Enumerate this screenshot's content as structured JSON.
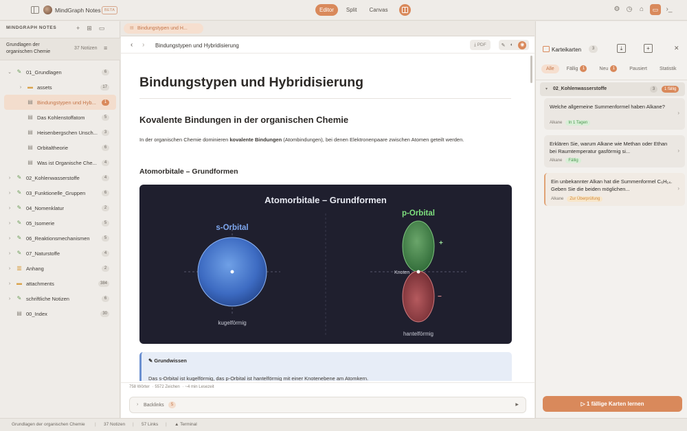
{
  "topbar": {
    "app_name": "MindGraph Notes",
    "beta": "BETA",
    "views": [
      "Editor",
      "Split",
      "Canvas"
    ],
    "active_view": "Editor"
  },
  "sidebar": {
    "title": "MINDGRAPH NOTES",
    "vault_name": "Grundlagen der organischen Chemie",
    "vault_count": "37 Notizen",
    "items": [
      {
        "label": "01_Grundlagen",
        "badge": "6",
        "icon": "pencil-icon",
        "level": 0,
        "expanded": true
      },
      {
        "label": "assets",
        "badge": "17",
        "icon": "folder-icon",
        "level": 1
      },
      {
        "label": "Bindungstypen und Hyb...",
        "badge": "1",
        "icon": "file-icon",
        "level": 1,
        "selected": true
      },
      {
        "label": "Das Kohlenstoffatom",
        "badge": "5",
        "icon": "file-icon",
        "level": 1
      },
      {
        "label": "Heisenbergschen Unsch...",
        "badge": "3",
        "icon": "file-icon",
        "level": 1
      },
      {
        "label": "Orbitaltheorie",
        "badge": "6",
        "icon": "file-icon",
        "level": 1
      },
      {
        "label": "Was ist Organische Che...",
        "badge": "4",
        "icon": "file-icon",
        "level": 1
      },
      {
        "label": "02_Kohlenwasserstoffe",
        "badge": "4",
        "icon": "pencil-icon",
        "level": 0
      },
      {
        "label": "03_Funktionelle_Gruppen",
        "badge": "6",
        "icon": "pencil-icon",
        "level": 0
      },
      {
        "label": "04_Nomenklatur",
        "badge": "2",
        "icon": "pencil-icon",
        "level": 0
      },
      {
        "label": "05_Isomerie",
        "badge": "5",
        "icon": "pencil-icon",
        "level": 0
      },
      {
        "label": "06_Reaktionsmechanismen",
        "badge": "5",
        "icon": "pencil-icon",
        "level": 0
      },
      {
        "label": "07_Naturstoffe",
        "badge": "4",
        "icon": "pencil-icon",
        "level": 0
      },
      {
        "label": "Anhang",
        "badge": "2",
        "icon": "books-icon",
        "level": 0
      },
      {
        "label": "attachments",
        "badge": "384",
        "icon": "folder-icon",
        "level": 0
      },
      {
        "label": "schriftliche Notizen",
        "badge": "6",
        "icon": "pencil-icon",
        "level": 0
      },
      {
        "label": "00_Index",
        "badge": "30",
        "icon": "file-icon",
        "level": 0,
        "no_chevron": true
      }
    ]
  },
  "editor": {
    "tab_label": "Bindungstypen und H...",
    "breadcrumb": "Bindungstypen und Hybridisierung",
    "pdf_label": "PDF",
    "title": "Bindungstypen und Hybridisierung",
    "h2": "Kovalente Bindungen in der organischen Chemie",
    "para_pre": "In der organischen Chemie dominieren ",
    "para_bold": "kovalente Bindungen",
    "para_post": " (Atombindungen), bei denen Elektronenpaare zwischen Atomen geteilt werden.",
    "h3": "Atomorbitale – Grundformen",
    "figure": {
      "title": "Atomorbitale – Grundformen",
      "s_label": "s-Orbital",
      "s_caption": "kugelförmig",
      "p_label": "p-Orbital",
      "p_caption": "hantelförmig",
      "plus": "+",
      "minus": "−",
      "node_label": "Knoten"
    },
    "callout_title": "Grundwissen",
    "callout_text": "Das s-Orbital ist kugelförmig, das p-Orbital ist hantelförmig mit einer Knotenebene am Atomkern.",
    "status": {
      "words": "758 Wörter",
      "chars": "5572 Zeichen",
      "read": "~4 min Lesezeit"
    },
    "backlinks_label": "Backlinks",
    "backlinks_count": "5"
  },
  "flashcards": {
    "title": "Karteikarten",
    "count": "3",
    "filters": [
      {
        "label": "Alle",
        "active": true
      },
      {
        "label": "Fällig",
        "badge": "1"
      },
      {
        "label": "Neu",
        "badge": "1"
      },
      {
        "label": "Pausiert"
      },
      {
        "label": "Statistik"
      }
    ],
    "deck_name": "02_Kohlenwasserstoffe",
    "deck_count": "3",
    "deck_due": "1 fällig",
    "cards": [
      {
        "question": "Welche allgemeine Summenformel haben Alkane?",
        "tag": "Alkane",
        "status": "In 1 Tagen",
        "status_color": "green"
      },
      {
        "question": "Erklären Sie, warum Alkane wie Methan oder Ethan bei Raumtemperatur gasförmig si...",
        "tag": "Alkane",
        "status": "Fällig",
        "status_color": "green"
      },
      {
        "question": "Ein unbekannter Alkan hat die Summenformel C₆H₁₄. Geben Sie die beiden möglichen...",
        "tag": "Alkane",
        "status": "Zur Überprüfung",
        "status_color": "orange"
      }
    ],
    "learn_button": "1 fällige Karten lernen"
  },
  "statusbar": {
    "vault": "Grundlagen der organischen Chemie",
    "notes": "37 Notizen",
    "links": "57 Links",
    "terminal": "Terminal"
  },
  "colors": {
    "accent": "#d9895b",
    "figure_bg": "#1f1f2e"
  }
}
